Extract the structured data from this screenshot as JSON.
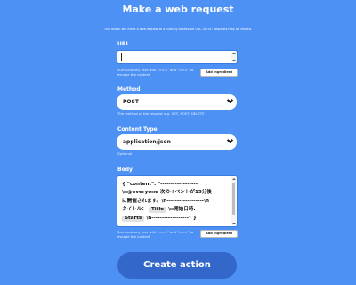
{
  "header": {
    "title": "Make a web request",
    "description": "This action will make a web request to a publicly accessible URL. NOTE: Requests may be limited."
  },
  "url": {
    "label": "URL",
    "value": "",
    "hint_line1": "Surround any text with \"<<<\" and \">>>\" to",
    "hint_line2": "escape the content",
    "add_ingredient": "Add ingredient"
  },
  "method": {
    "label": "Method",
    "value": "POST",
    "hint": "The method of the request e.g. GET, POST, DELETE"
  },
  "content_type": {
    "label": "Content Type",
    "value": "application/json",
    "hint": "Optional"
  },
  "body": {
    "label": "Body",
    "line1": "{ \"content\": \"------------------",
    "line2": "\\n@everyone 次のイベントが15分後",
    "line3": "に開催されます。\\n------------------\\n",
    "line4_prefix": "タイトル：",
    "title_chip": "Title",
    "line4_suffix": "\\n開始日時:",
    "starts_chip": "Starts",
    "line5_suffix": "\\n------------------\" }",
    "hint_line1": "Surround any text with \"<<<\" and \">>>\" to",
    "hint_line2": "escape the content",
    "add_ingredient": "Add ingredient"
  },
  "footer": {
    "create_label": "Create action"
  }
}
